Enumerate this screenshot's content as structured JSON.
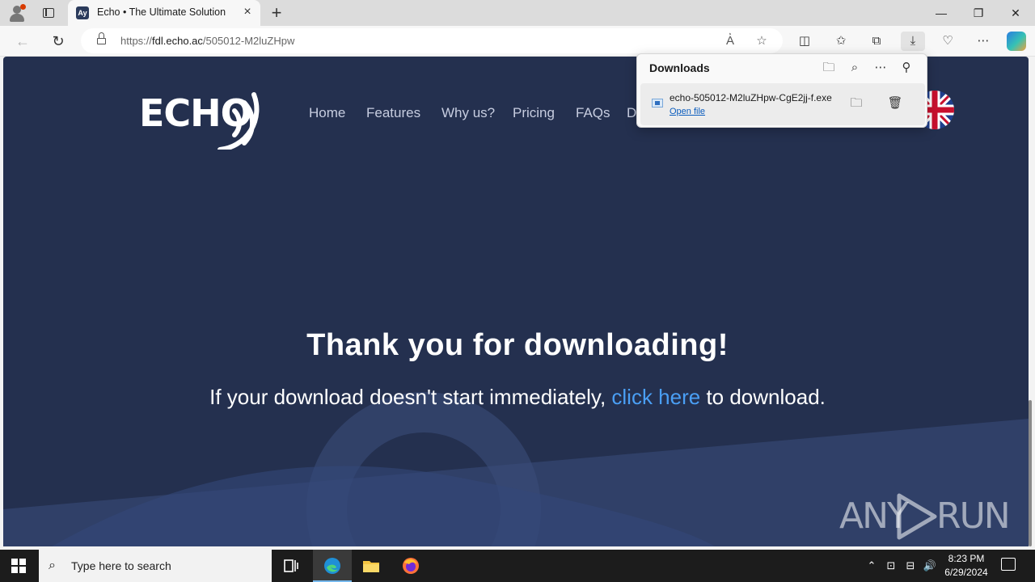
{
  "browser": {
    "tab_title": "Echo • The Ultimate Solution",
    "favicon_text": "Ay",
    "url_prefix": "https://",
    "url_host": "fdl.echo.ac",
    "url_path": "/505012-M2luZHpw"
  },
  "downloads": {
    "title": "Downloads",
    "filename": "echo-505012-M2luZHpw-CgE2jj-f.exe",
    "open_label": "Open file"
  },
  "site": {
    "logo_text": "ECHO",
    "nav": [
      "Home",
      "Features",
      "Why us?",
      "Pricing",
      "FAQs",
      "D"
    ],
    "heading": "Thank you for downloading!",
    "sub_before": "If your download doesn't start immediately, ",
    "sub_link": "click here",
    "sub_after": " to download.",
    "page_bg": "#24304f",
    "link_color": "#4a9ff5"
  },
  "watermark": {
    "left": "ANY",
    "right": "RUN"
  },
  "taskbar": {
    "search_placeholder": "Type here to search",
    "time": "8:23 PM",
    "date": "6/29/2024"
  }
}
